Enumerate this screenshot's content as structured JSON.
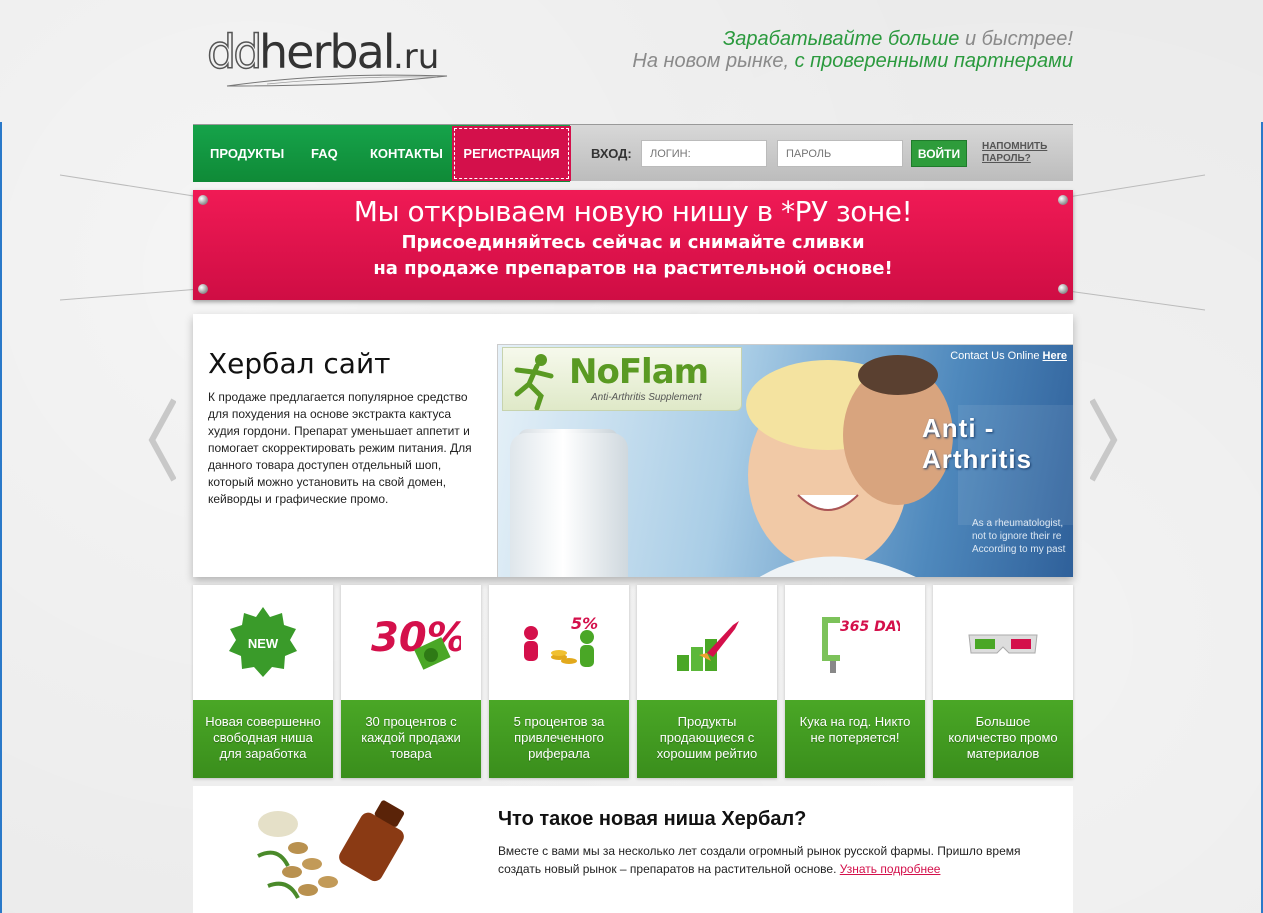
{
  "header": {
    "logo_text": "ddherbal.ru",
    "tagline": {
      "line1_a": "Зарабатывайте больше",
      "line1_b": " и быстрее!",
      "line2_a": "На новом рынке,",
      "line2_b": " с проверенными партнерами"
    }
  },
  "nav": {
    "items": [
      "ПРОДУКТЫ",
      "FAQ",
      "КОНТАКТЫ"
    ],
    "register": "РЕГИСТРАЦИЯ",
    "login_label": "ВХОД:",
    "login_placeholder": "ЛОГИН:",
    "password_placeholder": "ПАРОЛЬ",
    "login_button": "ВОЙТИ",
    "remind_line1": "НАПОМНИТЬ",
    "remind_line2": "ПАРОЛЬ?"
  },
  "banner": {
    "title": "Мы открываем новую нишу в *РУ зоне!",
    "line1": "Присоединяйтесь сейчас и снимайте сливки",
    "line2": "на продаже препаратов на растительной основе!"
  },
  "slider": {
    "title": "Хербал сайт",
    "description": "К продаже предлагается популярное средство для похудения на основе экстракта кактуса худия гордони. Препарат уменьшает аппетит и помогает скорректировать режим питания. Для данного товара доступен отдельный шоп, который можно установить на свой домен, кейворды и графические промо.",
    "image": {
      "brand": "NoFlam",
      "brand_sub": "Anti-Arthritis Supplement",
      "contact": "Contact Us Online",
      "contact_link": "Here",
      "headline": "Anti - Arthritis",
      "text_lines": [
        "As a rheumatologist,",
        "not to ignore their re",
        "According to my past"
      ]
    }
  },
  "features": [
    {
      "icon": "new-badge-icon",
      "badge": "NEW",
      "label": "Новая совершенно свободная ниша для заработка"
    },
    {
      "icon": "percent-30-icon",
      "badge": "30%",
      "label": "30 процентов с каждой продажи товара"
    },
    {
      "icon": "referral-5-percent-icon",
      "badge": "5%",
      "label": "5 процентов за привлеченного риферала"
    },
    {
      "icon": "rocket-chart-icon",
      "badge": "",
      "label": "Продукты продающиеся с хорошим рейтио"
    },
    {
      "icon": "clamp-365-icon",
      "badge": "365 DAY",
      "label": "Кука на год. Никто не потеряется!"
    },
    {
      "icon": "3d-glasses-icon",
      "badge": "",
      "label": "Большое количество промо материалов"
    }
  ],
  "about": {
    "title": "Что такое новая ниша Хербал?",
    "text": "Вместе с вами мы за несколько лет создали огромный рынок русской фармы. Пришло время создать новый рынок – препаратов на растительной основе. ",
    "link": "Узнать подробнее"
  },
  "colors": {
    "green": "#16a34a",
    "pink": "#d4104b",
    "feature_green": "#4aa726"
  }
}
